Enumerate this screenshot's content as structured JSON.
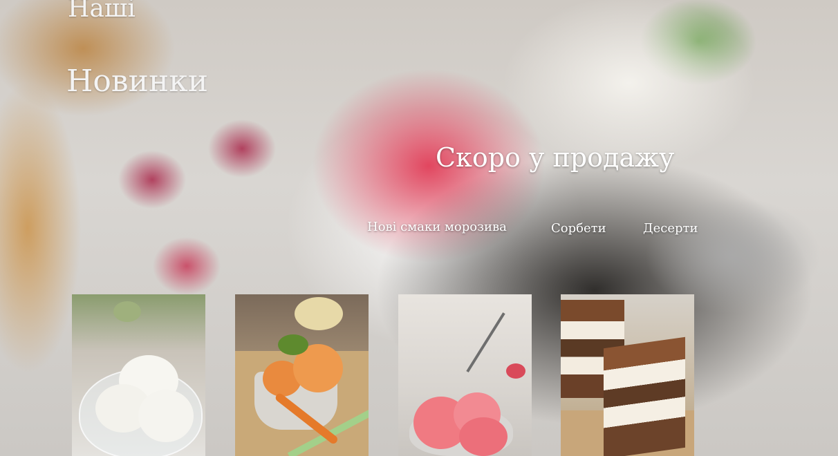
{
  "headings": {
    "top": "Наші",
    "main": "Новинки",
    "coming_soon": "Скоро у продажу"
  },
  "nav": {
    "items": [
      {
        "label": "Нові смаки морозива"
      },
      {
        "label": "Сорбети"
      },
      {
        "label": "Десерти"
      }
    ]
  },
  "products": [
    {
      "icon": "vanilla-ice-cream-image"
    },
    {
      "icon": "carrot-sorbet-image"
    },
    {
      "icon": "berry-sorbet-image"
    },
    {
      "icon": "tiramisu-image"
    }
  ],
  "colors": {
    "heading_text": "#f4f4f4",
    "nav_text": "#ffffff",
    "hero_accent": "#e2465f"
  }
}
